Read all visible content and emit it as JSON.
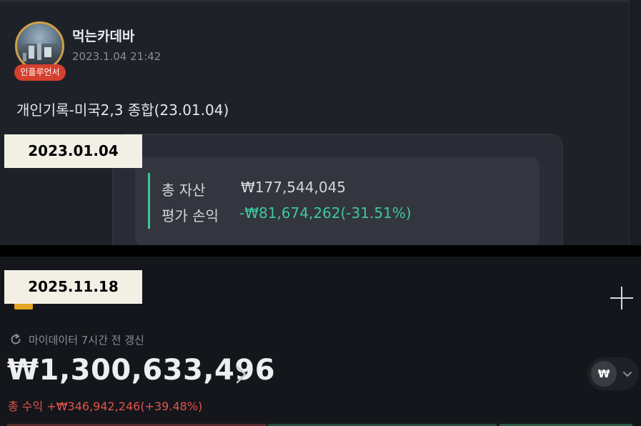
{
  "date_labels": {
    "before": "2023.01.04",
    "after": "2025.11.18"
  },
  "post": {
    "author": "먹는카데바",
    "badge": "인플루언서",
    "timestamp": "2023.1.04 21:42",
    "title": "개인기록-미국2,3 종합(23.01.04)",
    "card": {
      "total_assets_label": "총 자산",
      "total_assets_value": "₩177,544,045",
      "valuation_pl_label": "평가 손익",
      "valuation_pl_value": "-₩81,674,262(-31.51%)"
    }
  },
  "portfolio": {
    "refresh_text": "마이데이터 7시간 전 갱신",
    "balance": "₩1,300,633,496",
    "currency_symbol": "₩",
    "total_return": "총 수익 +₩346,942,246(+39.48%)"
  },
  "colors": {
    "gain_green": "#3ec89a",
    "return_red": "#e4524c",
    "badge_red": "#d5402e",
    "avatar_ring": "#d1a046"
  },
  "icons": [
    "refresh-icon",
    "plus-icon",
    "chevron-right-icon",
    "chevron-down-icon"
  ]
}
